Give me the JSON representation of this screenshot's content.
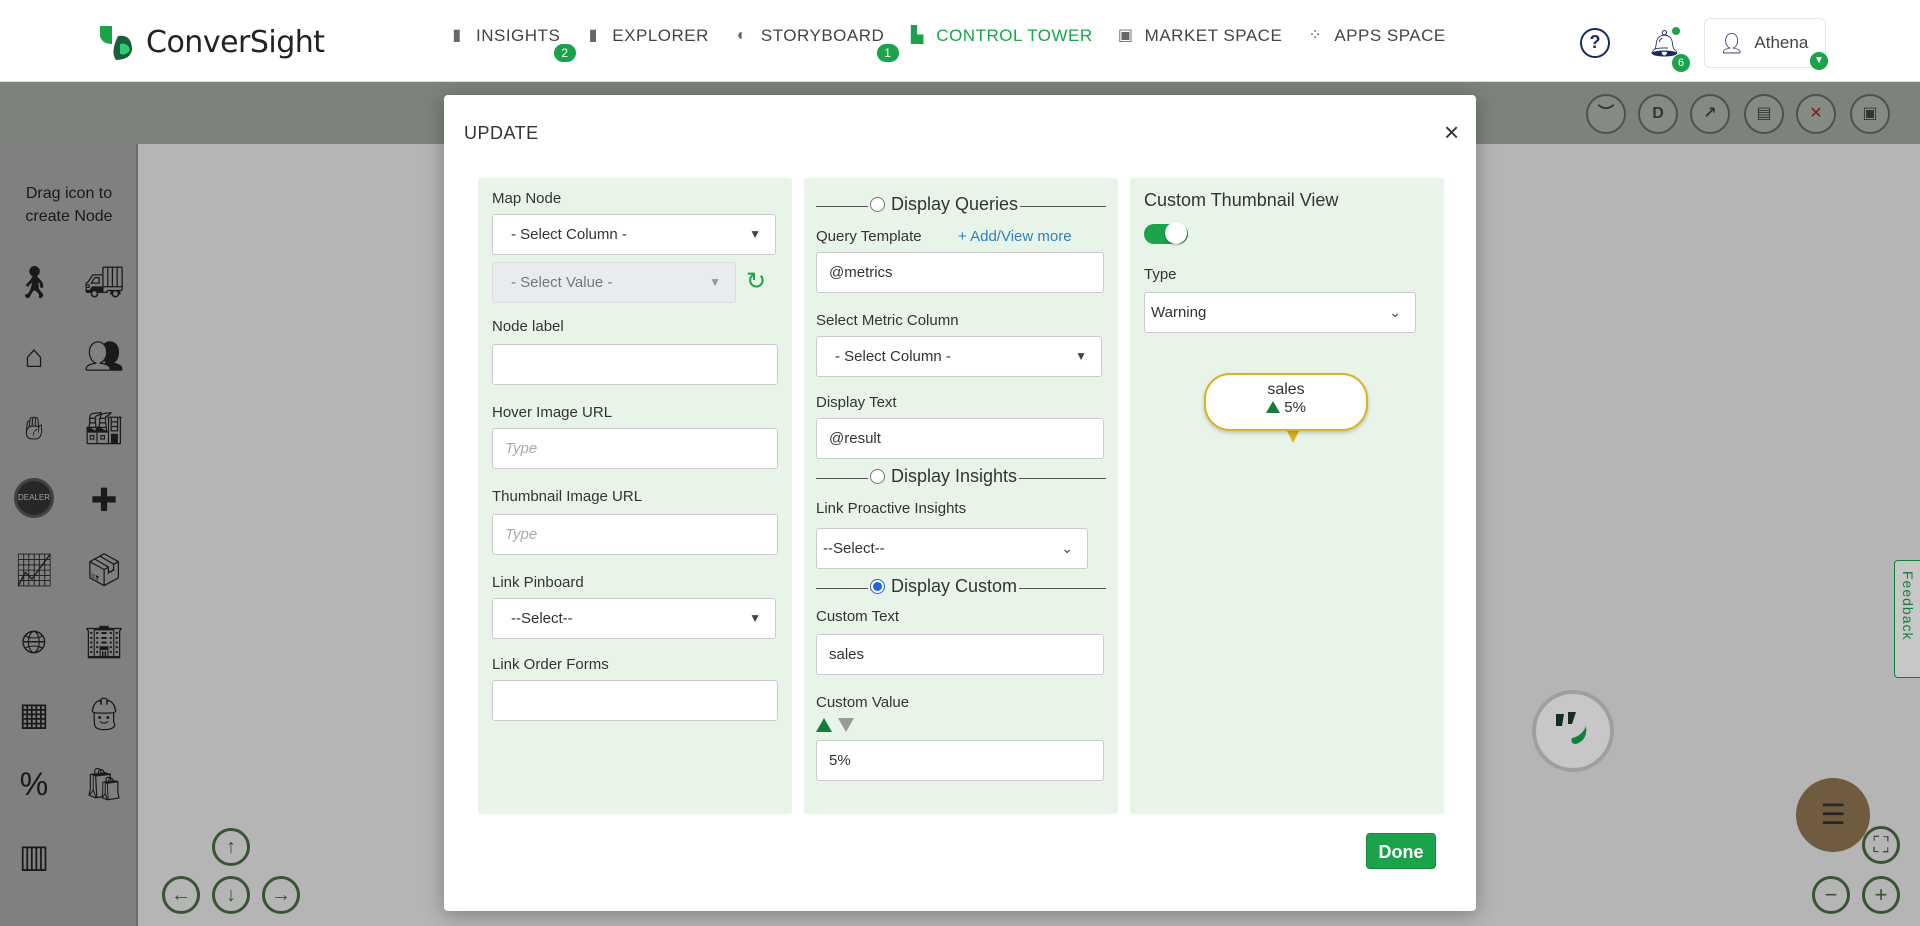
{
  "app": {
    "brand": "ConverSight"
  },
  "nav": [
    {
      "label": "INSIGHTS",
      "icon": "bar-chart-icon",
      "badge": "2"
    },
    {
      "label": "EXPLORER",
      "icon": "bar-chart-icon",
      "badge": ""
    },
    {
      "label": "STORYBOARD",
      "icon": "globe-icon",
      "badge": "1"
    },
    {
      "label": "CONTROL TOWER",
      "icon": "tower-icon",
      "badge": "",
      "active": true
    },
    {
      "label": "MARKET SPACE",
      "icon": "store-icon",
      "badge": ""
    },
    {
      "label": "APPS SPACE",
      "icon": "grid-icon",
      "badge": ""
    }
  ],
  "header": {
    "notifications": "6",
    "user": "Athena"
  },
  "toolbar": {
    "d_label": "D"
  },
  "sidebar": {
    "drag_text": "Drag icon to create Node"
  },
  "feedback": "Feedback",
  "modal": {
    "title": "UPDATE",
    "done_label": "Done",
    "left": {
      "map_node_label": "Map Node",
      "select_column": "- Select Column -",
      "select_value": "- Select Value -",
      "node_label": "Node label",
      "node_label_value": "",
      "hover_url_label": "Hover Image URL",
      "hover_url_placeholder": "Type",
      "thumb_url_label": "Thumbnail Image URL",
      "thumb_url_placeholder": "Type",
      "pinboard_label": "Link Pinboard",
      "pinboard_value": "--Select--",
      "order_forms_label": "Link Order Forms",
      "order_forms_value": ""
    },
    "middle": {
      "display_queries": "Display Queries",
      "query_template_label": "Query Template",
      "add_view_more": "+ Add/View more",
      "query_template_value": "@metrics",
      "metric_column_label": "Select Metric Column",
      "metric_column_value": "- Select Column -",
      "display_text_label": "Display Text",
      "display_text_value": "@result",
      "display_insights": "Display Insights",
      "proactive_label": "Link Proactive Insights",
      "proactive_value": "--Select--",
      "display_custom": "Display Custom",
      "custom_text_label": "Custom Text",
      "custom_text_value": "sales",
      "custom_value_label": "Custom Value",
      "custom_value_value": "5%"
    },
    "right": {
      "title": "Custom Thumbnail View",
      "type_label": "Type",
      "type_value": "Warning",
      "preview_title": "sales",
      "preview_value": "5%"
    }
  },
  "colors": {
    "accent": "#1aa34a",
    "warning": "#d9b21c",
    "link": "#2f7fc1"
  }
}
